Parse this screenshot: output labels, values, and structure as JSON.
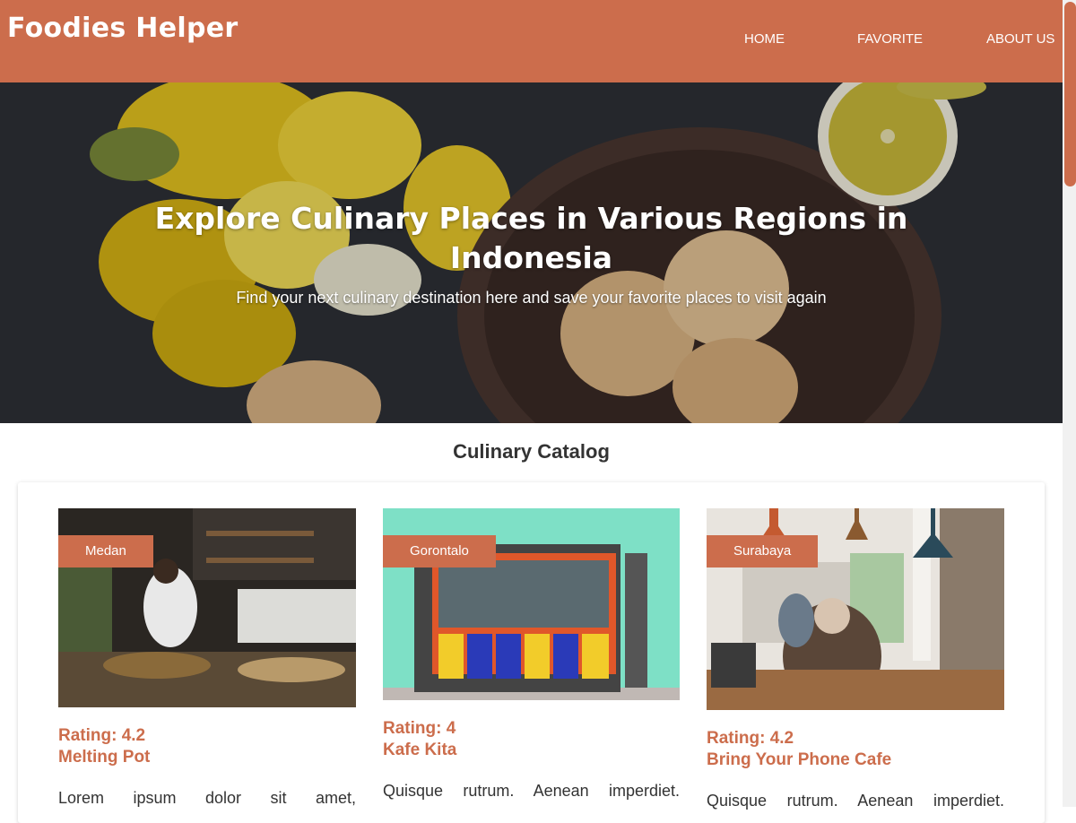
{
  "app": {
    "brand": "Foodies Helper"
  },
  "nav": [
    {
      "label": "HOME"
    },
    {
      "label": "FAVORITE"
    },
    {
      "label": "ABOUT US"
    }
  ],
  "hero": {
    "title": "Explore Culinary Places in Various Regions in Indonesia",
    "subtitle": "Find your next culinary destination here and save your favorite places to visit again"
  },
  "catalog": {
    "title": "Culinary Catalog",
    "items": [
      {
        "city": "Medan",
        "rating_label": "Rating: 4.2",
        "name": "Melting Pot",
        "description": "Lorem ipsum dolor sit amet,"
      },
      {
        "city": "Gorontalo",
        "rating_label": "Rating: 4",
        "name": "Kafe Kita",
        "description": "Quisque rutrum. Aenean imperdiet."
      },
      {
        "city": "Surabaya",
        "rating_label": "Rating: 4.2",
        "name": "Bring Your Phone Cafe",
        "description": "Quisque rutrum. Aenean imperdiet."
      }
    ]
  },
  "colors": {
    "accent": "#cc6d4c",
    "text": "#333333"
  }
}
